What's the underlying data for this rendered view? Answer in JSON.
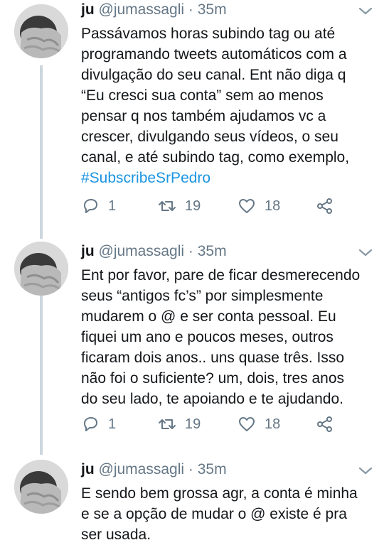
{
  "tweets": [
    {
      "name": "ju",
      "handle": "@jumassagli",
      "sep": " · ",
      "time": "35m",
      "lines": [
        "Passávamos horas subindo tag ou até",
        "programando tweets automáticos com a",
        "divulgação do seu canal. Ent não diga q",
        "“Eu cresci sua conta” sem ao menos",
        "pensar q nos também ajudamos vc a",
        "crescer, divulgando seus vídeos, o seu",
        "canal, e até subindo tag, como exemplo,"
      ],
      "hashtag": "#SubscribeSrPedro",
      "replies": "1",
      "retweets": "19",
      "likes": "18"
    },
    {
      "name": "ju",
      "handle": "@jumassagli",
      "sep": " · ",
      "time": "35m",
      "lines": [
        "Ent por favor, pare de ficar desmerecendo",
        "seus “antigos fc’s” por simplesmente",
        "mudarem o @ e ser conta pessoal. Eu",
        "fiquei um ano e poucos meses, outros",
        "ficaram dois anos.. uns quase três. Isso",
        "não foi o suficiente? um, dois, tres anos",
        "do seu lado, te apoiando e te ajudando."
      ],
      "replies": "1",
      "retweets": "19",
      "likes": "18"
    },
    {
      "name": "ju",
      "handle": "@jumassagli",
      "sep": " · ",
      "time": "35m",
      "lines": [
        "E sendo bem grossa agr, a conta é minha",
        "e se a opção de mudar o @ existe é pra",
        "ser usada."
      ]
    }
  ],
  "icons": {
    "reply": "reply-icon",
    "retweet": "retweet-icon",
    "like": "heart-icon",
    "share": "share-icon",
    "more": "chevron-down-icon"
  },
  "colors": {
    "text": "#14171a",
    "muted": "#657786",
    "link": "#1b95e0",
    "thread_line": "#ccd6dd"
  }
}
